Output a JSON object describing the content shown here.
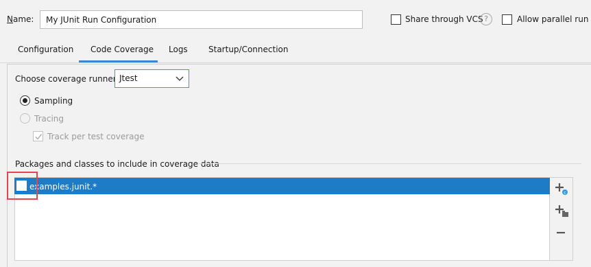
{
  "header": {
    "name_label_prefix": "N",
    "name_label_rest": "ame:",
    "name_value": "My JUnit Run Configuration",
    "share_vcs_label": "Share through VCS",
    "help_glyph": "?",
    "allow_parallel_label": "Allow parallel run"
  },
  "tabs": [
    {
      "label": "Configuration"
    },
    {
      "label": "Code Coverage",
      "active": true
    },
    {
      "label": "Logs"
    },
    {
      "label": "Startup/Connection"
    }
  ],
  "coverage": {
    "runner_label": "Choose coverage runner:",
    "runner_value": "Jtest",
    "sampling_label": "Sampling",
    "tracing_label": "Tracing",
    "track_per_test_label": "Track per test coverage",
    "section_label": "Packages and classes to include in coverage data",
    "items": [
      {
        "label": "examples.junit.*",
        "checked": false,
        "selected": true
      }
    ]
  },
  "colors": {
    "selection": "#1e7bc6",
    "highlight": "#e0474c",
    "accent": "#3b87cf"
  },
  "icons": {
    "add": "add-class-icon",
    "add_package": "add-package-icon",
    "remove": "remove-icon",
    "help": "help-icon",
    "dropdown": "chevron-down-icon"
  }
}
